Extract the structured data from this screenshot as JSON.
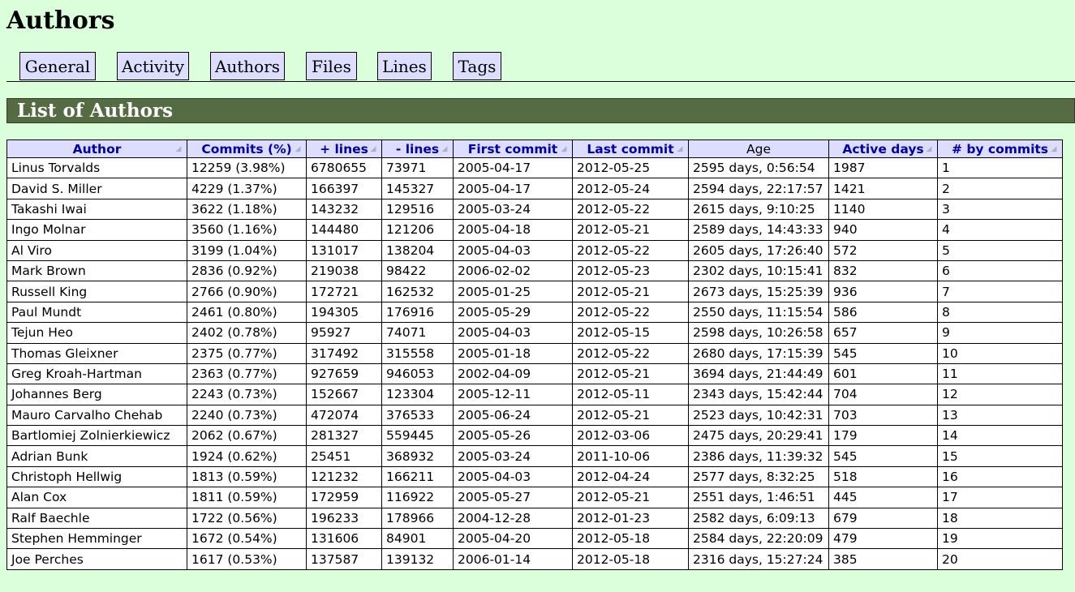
{
  "page": {
    "title": "Authors"
  },
  "nav": {
    "tabs": [
      "General",
      "Activity",
      "Authors",
      "Files",
      "Lines",
      "Tags"
    ]
  },
  "section": {
    "title": "List of Authors"
  },
  "table": {
    "headers": [
      "Author",
      "Commits (%)",
      "+ lines",
      "- lines",
      "First commit",
      "Last commit",
      "Age",
      "Active days",
      "# by commits"
    ],
    "rows": [
      [
        "Linus Torvalds",
        "12259 (3.98%)",
        "6780655",
        "73971",
        "2005-04-17",
        "2012-05-25",
        "2595 days, 0:56:54",
        "1987",
        "1"
      ],
      [
        "David S. Miller",
        "4229 (1.37%)",
        "166397",
        "145327",
        "2005-04-17",
        "2012-05-24",
        "2594 days, 22:17:57",
        "1421",
        "2"
      ],
      [
        "Takashi Iwai",
        "3622 (1.18%)",
        "143232",
        "129516",
        "2005-03-24",
        "2012-05-22",
        "2615 days, 9:10:25",
        "1140",
        "3"
      ],
      [
        "Ingo Molnar",
        "3560 (1.16%)",
        "144480",
        "121206",
        "2005-04-18",
        "2012-05-21",
        "2589 days, 14:43:33",
        "940",
        "4"
      ],
      [
        "Al Viro",
        "3199 (1.04%)",
        "131017",
        "138204",
        "2005-04-03",
        "2012-05-22",
        "2605 days, 17:26:40",
        "572",
        "5"
      ],
      [
        "Mark Brown",
        "2836 (0.92%)",
        "219038",
        "98422",
        "2006-02-02",
        "2012-05-23",
        "2302 days, 10:15:41",
        "832",
        "6"
      ],
      [
        "Russell King",
        "2766 (0.90%)",
        "172721",
        "162532",
        "2005-01-25",
        "2012-05-21",
        "2673 days, 15:25:39",
        "936",
        "7"
      ],
      [
        "Paul Mundt",
        "2461 (0.80%)",
        "194305",
        "176916",
        "2005-05-29",
        "2012-05-22",
        "2550 days, 11:15:54",
        "586",
        "8"
      ],
      [
        "Tejun Heo",
        "2402 (0.78%)",
        "95927",
        "74071",
        "2005-04-03",
        "2012-05-15",
        "2598 days, 10:26:58",
        "657",
        "9"
      ],
      [
        "Thomas Gleixner",
        "2375 (0.77%)",
        "317492",
        "315558",
        "2005-01-18",
        "2012-05-22",
        "2680 days, 17:15:39",
        "545",
        "10"
      ],
      [
        "Greg Kroah-Hartman",
        "2363 (0.77%)",
        "927659",
        "946053",
        "2002-04-09",
        "2012-05-21",
        "3694 days, 21:44:49",
        "601",
        "11"
      ],
      [
        "Johannes Berg",
        "2243 (0.73%)",
        "152667",
        "123304",
        "2005-12-11",
        "2012-05-11",
        "2343 days, 15:42:44",
        "704",
        "12"
      ],
      [
        "Mauro Carvalho Chehab",
        "2240 (0.73%)",
        "472074",
        "376533",
        "2005-06-24",
        "2012-05-21",
        "2523 days, 10:42:31",
        "703",
        "13"
      ],
      [
        "Bartlomiej Zolnierkiewicz",
        "2062 (0.67%)",
        "281327",
        "559445",
        "2005-05-26",
        "2012-03-06",
        "2475 days, 20:29:41",
        "179",
        "14"
      ],
      [
        "Adrian Bunk",
        "1924 (0.62%)",
        "25451",
        "368932",
        "2005-03-24",
        "2011-10-06",
        "2386 days, 11:39:32",
        "545",
        "15"
      ],
      [
        "Christoph Hellwig",
        "1813 (0.59%)",
        "121232",
        "166211",
        "2005-04-03",
        "2012-04-24",
        "2577 days, 8:32:25",
        "518",
        "16"
      ],
      [
        "Alan Cox",
        "1811 (0.59%)",
        "172959",
        "116922",
        "2005-05-27",
        "2012-05-21",
        "2551 days, 1:46:51",
        "445",
        "17"
      ],
      [
        "Ralf Baechle",
        "1722 (0.56%)",
        "196233",
        "178966",
        "2004-12-28",
        "2012-01-23",
        "2582 days, 6:09:13",
        "679",
        "18"
      ],
      [
        "Stephen Hemminger",
        "1672 (0.54%)",
        "131606",
        "84901",
        "2005-04-20",
        "2012-05-18",
        "2584 days, 22:20:09",
        "479",
        "19"
      ],
      [
        "Joe Perches",
        "1617 (0.53%)",
        "137587",
        "139132",
        "2006-01-14",
        "2012-05-18",
        "2316 days, 15:27:24",
        "385",
        "20"
      ]
    ]
  },
  "icons": {
    "sort": "sort-arrows-icon"
  }
}
